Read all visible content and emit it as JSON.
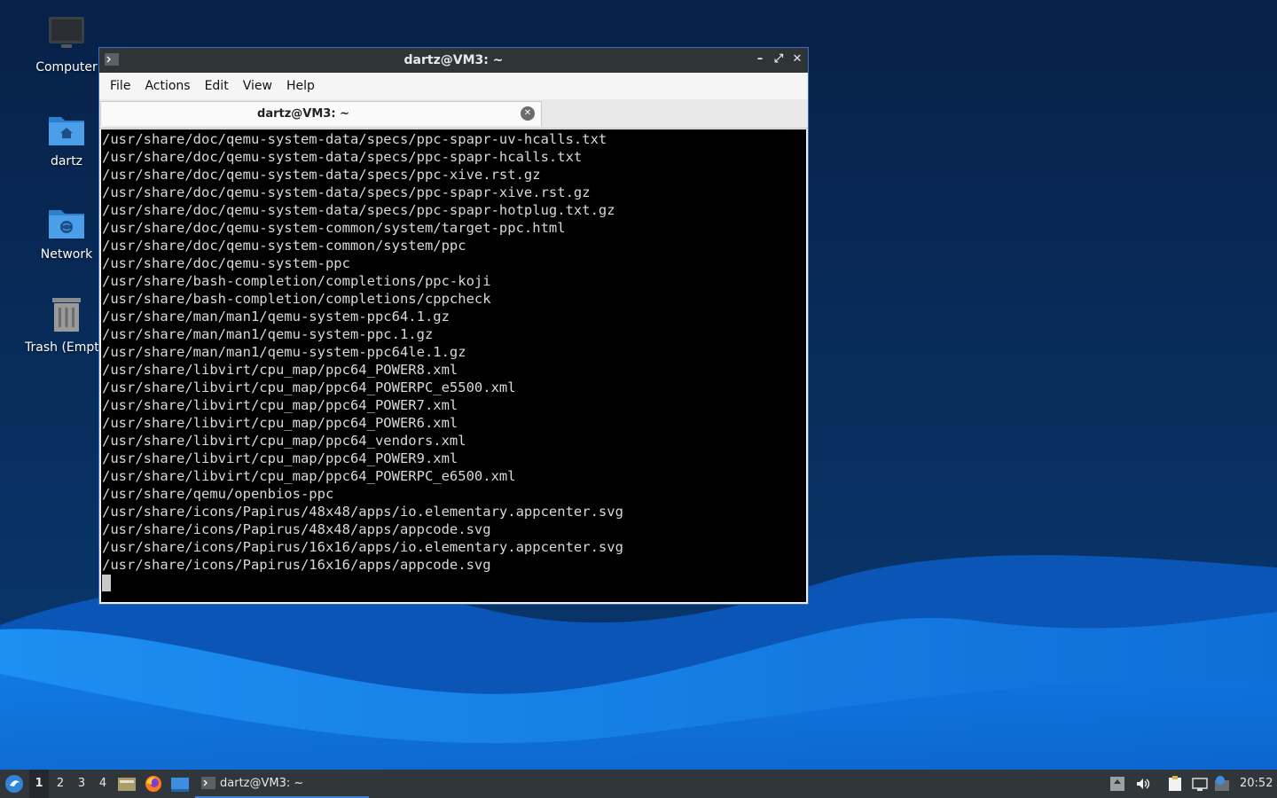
{
  "desktop": {
    "icons": [
      {
        "label": "Computer"
      },
      {
        "label": "dartz"
      },
      {
        "label": "Network"
      },
      {
        "label": "Trash (Empty)"
      }
    ]
  },
  "window": {
    "title": "dartz@VM3: ~",
    "menu": [
      "File",
      "Actions",
      "Edit",
      "View",
      "Help"
    ],
    "tab_label": "dartz@VM3: ~"
  },
  "terminal": {
    "lines": [
      "/usr/share/doc/qemu-system-data/specs/ppc-spapr-uv-hcalls.txt",
      "/usr/share/doc/qemu-system-data/specs/ppc-spapr-hcalls.txt",
      "/usr/share/doc/qemu-system-data/specs/ppc-xive.rst.gz",
      "/usr/share/doc/qemu-system-data/specs/ppc-spapr-xive.rst.gz",
      "/usr/share/doc/qemu-system-data/specs/ppc-spapr-hotplug.txt.gz",
      "/usr/share/doc/qemu-system-common/system/target-ppc.html",
      "/usr/share/doc/qemu-system-common/system/ppc",
      "/usr/share/doc/qemu-system-ppc",
      "/usr/share/bash-completion/completions/ppc-koji",
      "/usr/share/bash-completion/completions/cppcheck",
      "/usr/share/man/man1/qemu-system-ppc64.1.gz",
      "/usr/share/man/man1/qemu-system-ppc.1.gz",
      "/usr/share/man/man1/qemu-system-ppc64le.1.gz",
      "/usr/share/libvirt/cpu_map/ppc64_POWER8.xml",
      "/usr/share/libvirt/cpu_map/ppc64_POWERPC_e5500.xml",
      "/usr/share/libvirt/cpu_map/ppc64_POWER7.xml",
      "/usr/share/libvirt/cpu_map/ppc64_POWER6.xml",
      "/usr/share/libvirt/cpu_map/ppc64_vendors.xml",
      "/usr/share/libvirt/cpu_map/ppc64_POWER9.xml",
      "/usr/share/libvirt/cpu_map/ppc64_POWERPC_e6500.xml",
      "/usr/share/qemu/openbios-ppc",
      "/usr/share/icons/Papirus/48x48/apps/io.elementary.appcenter.svg",
      "/usr/share/icons/Papirus/48x48/apps/appcode.svg",
      "/usr/share/icons/Papirus/16x16/apps/io.elementary.appcenter.svg",
      "/usr/share/icons/Papirus/16x16/apps/appcode.svg"
    ]
  },
  "taskbar": {
    "workspaces": [
      "1",
      "2",
      "3",
      "4"
    ],
    "active_workspace": "1",
    "task_label": "dartz@VM3: ~",
    "clock": "20:52"
  },
  "colors": {
    "accent": "#3b82d6",
    "panel": "#31363b",
    "titlebar": "#2f3437"
  },
  "icons": [
    "start-menu-icon",
    "file-manager-icon",
    "firefox-icon",
    "show-desktop-icon",
    "terminal-icon",
    "volume-icon",
    "clipboard-icon",
    "network-icon",
    "update-icon"
  ]
}
